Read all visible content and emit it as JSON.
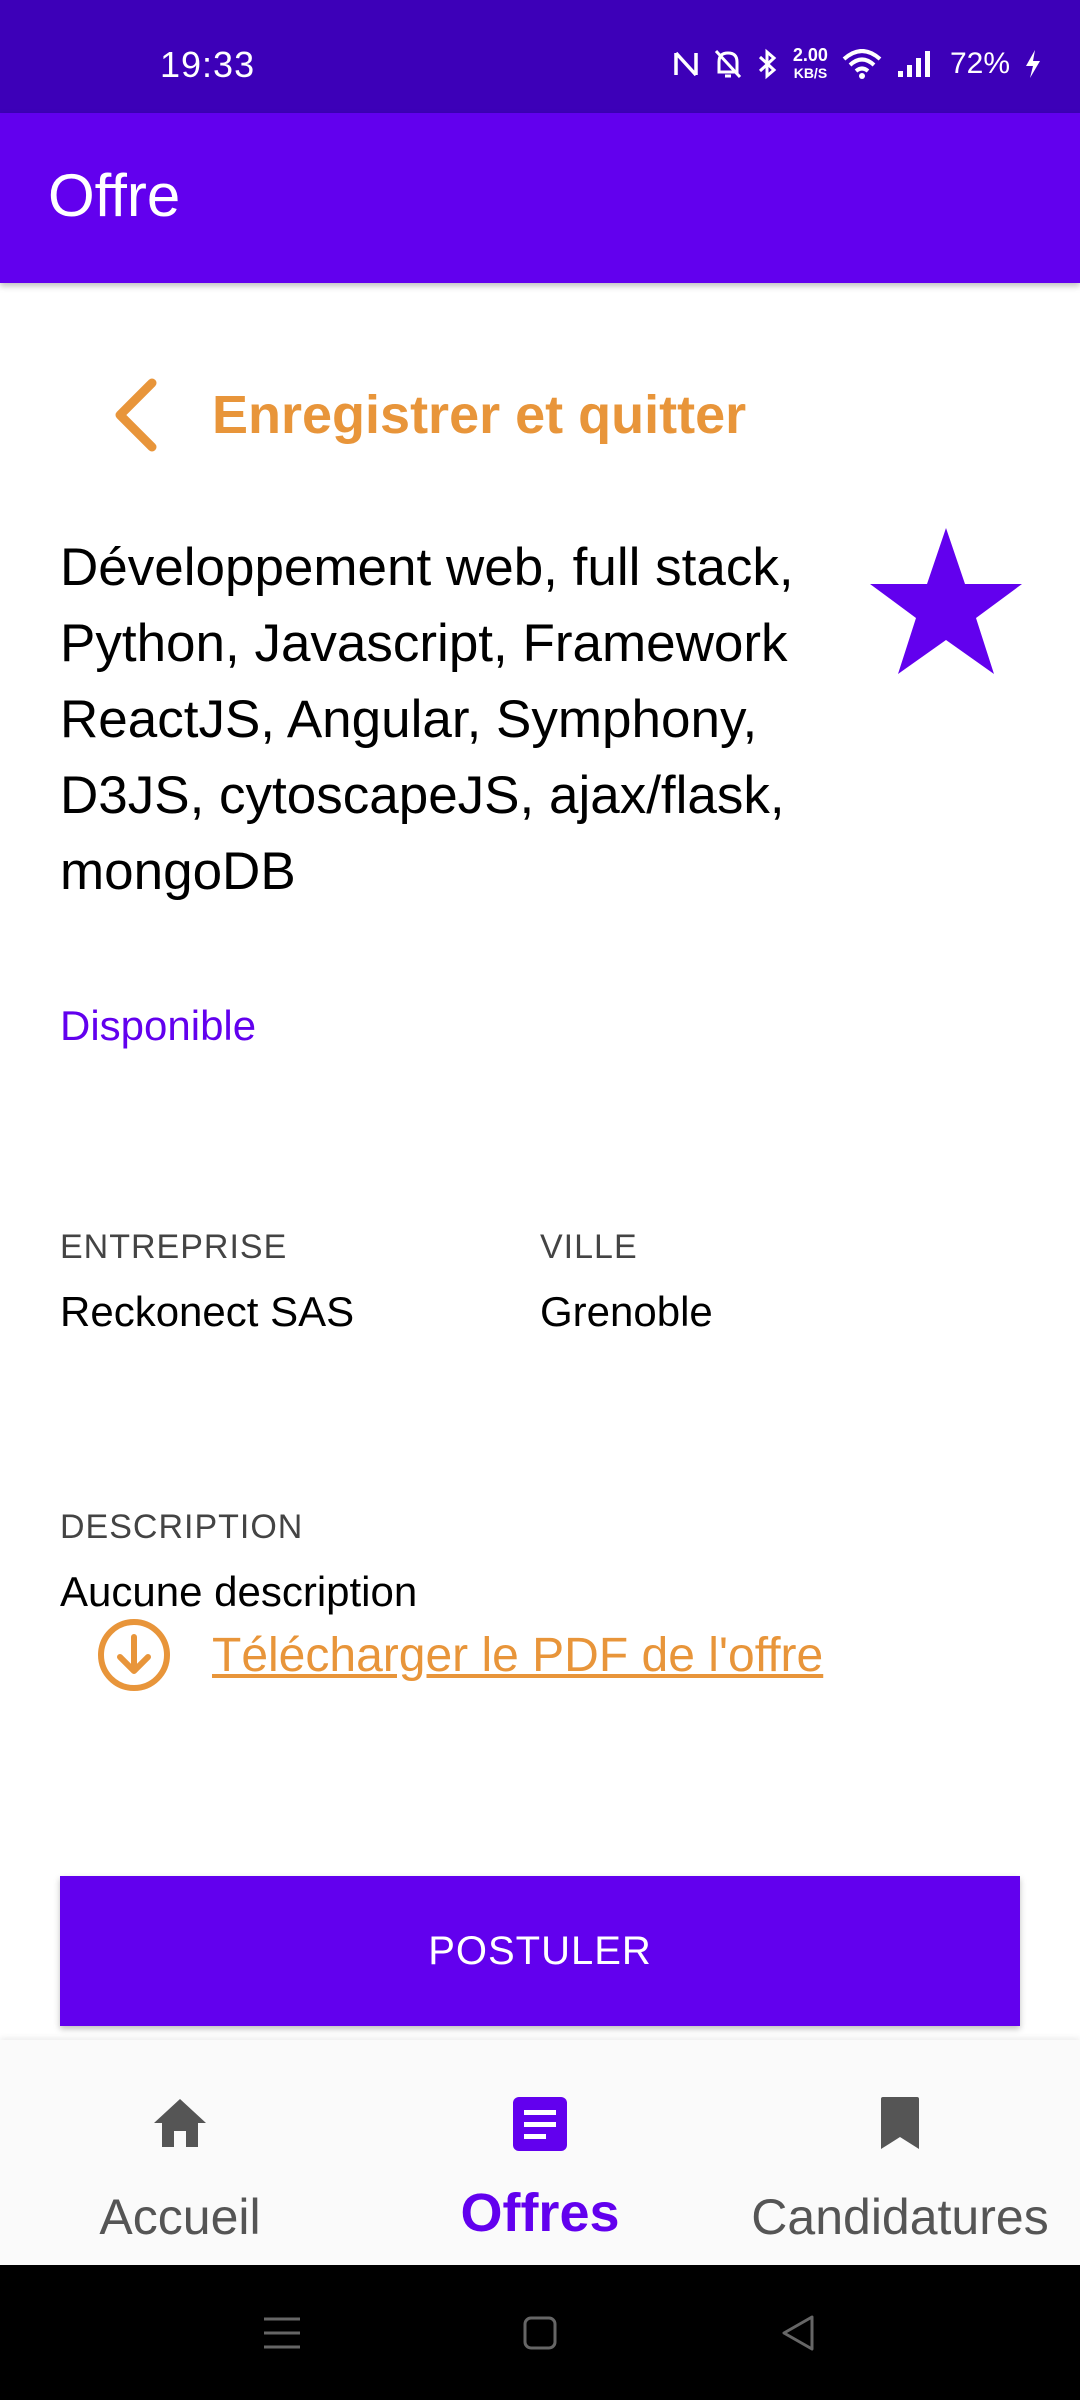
{
  "status_bar": {
    "time": "19:33",
    "net_speed_value": "2.00",
    "net_speed_unit": "KB/S",
    "battery": "72%",
    "icons": [
      "nfc-icon",
      "mute-icon",
      "bluetooth-icon",
      "wifi-icon",
      "signal-icon",
      "charging-icon"
    ]
  },
  "app_bar": {
    "title": "Offre"
  },
  "back": {
    "label": "Enregistrer et quitter",
    "icon": "chevron-left-icon"
  },
  "offer": {
    "title": "Développement web, full stack, Python, Javascript, Framework ReactJS, Angular, Symphony, D3JS, cytoscapeJS, ajax/flask, mongoDB",
    "status": "Disponible",
    "favorite": true,
    "company_label": "ENTREPRISE",
    "company": "Reckonect SAS",
    "city_label": "VILLE",
    "city": "Grenoble",
    "description_label": "DESCRIPTION",
    "description": "Aucune description",
    "pdf_link": "Télécharger le PDF de l'offre"
  },
  "apply_button": "POSTULER",
  "bottom_nav": {
    "items": [
      {
        "label": "Accueil",
        "icon": "home-icon",
        "active": false
      },
      {
        "label": "Offres",
        "icon": "document-icon",
        "active": true
      },
      {
        "label": "Candidatures",
        "icon": "bookmark-icon",
        "active": false
      }
    ]
  },
  "colors": {
    "status_bar": "#3d00b8",
    "primary": "#6200ee",
    "accent": "#e8953a"
  }
}
